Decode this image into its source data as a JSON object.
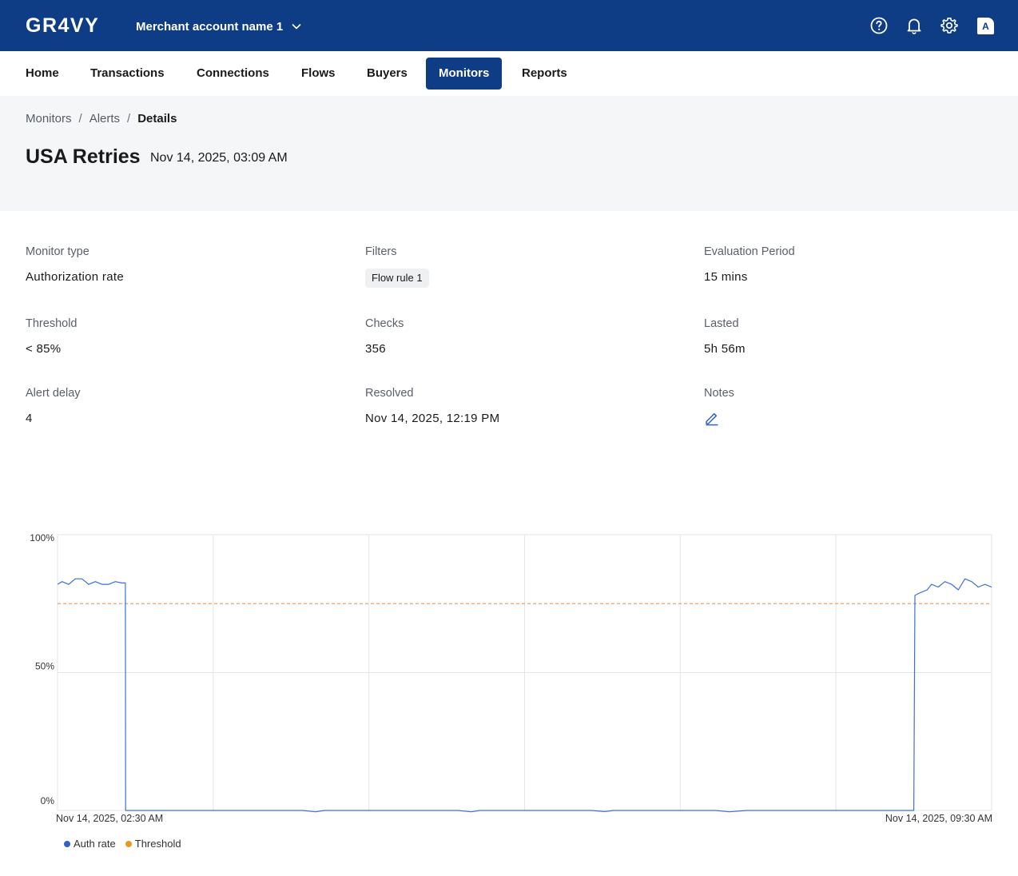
{
  "app": {
    "logo": "GR4VY"
  },
  "topbar": {
    "merchant": "Merchant account name 1",
    "avatar_letter": "A"
  },
  "nav": {
    "items": [
      {
        "label": "Home"
      },
      {
        "label": "Transactions"
      },
      {
        "label": "Connections"
      },
      {
        "label": "Flows"
      },
      {
        "label": "Buyers"
      },
      {
        "label": "Monitors",
        "active": true
      },
      {
        "label": "Reports"
      }
    ]
  },
  "breadcrumb": [
    "Monitors",
    "Alerts",
    "Details"
  ],
  "page": {
    "title": "USA Retries",
    "date": "Nov 14, 2025, 03:09 AM"
  },
  "details": {
    "monitor_type": {
      "label": "Monitor type",
      "value": "Authorization rate"
    },
    "filters": {
      "label": "Filters",
      "chip": "Flow rule 1"
    },
    "evaluation_period": {
      "label": "Evaluation Period",
      "value": "15 mins"
    },
    "threshold": {
      "label": "Threshold",
      "value": "< 85%"
    },
    "checks": {
      "label": "Checks",
      "value": "356"
    },
    "lasted": {
      "label": "Lasted",
      "value": "5h 56m"
    },
    "alert_delay": {
      "label": "Alert delay",
      "value": "4"
    },
    "resolved": {
      "label": "Resolved",
      "value": "Nov 14, 2025, 12:19 PM"
    },
    "notes": {
      "label": "Notes"
    }
  },
  "colors": {
    "brand": "#0e3d86",
    "auth_rate_line": "#3b6fd8",
    "threshold_line": "#f0a060",
    "grid": "#e6e6e6"
  },
  "chart_data": {
    "type": "line",
    "y_tick_labels": [
      "100%",
      "50%",
      "0%"
    ],
    "x_tick_labels": [
      "Nov 14, 2025, 02:30 AM",
      "Nov 14, 2025, 09:30 AM"
    ],
    "ylim": [
      0,
      100
    ],
    "x_range_minutes": [
      0,
      420
    ],
    "grid": true,
    "legend": "bottom-left",
    "series": [
      {
        "name": "Auth rate",
        "color": "#3b6fd8",
        "x_minutes": [
          0,
          2,
          5,
          8,
          11,
          14,
          17,
          20,
          23,
          26,
          29,
          30.5,
          30.6,
          60,
          110,
          116,
          120,
          160,
          180,
          186,
          190,
          230,
          240,
          246,
          250,
          280,
          296,
          302,
          310,
          385,
          385.5,
          388,
          391,
          393,
          396,
          399,
          402,
          405,
          408,
          411,
          414,
          417,
          420
        ],
        "values": [
          82,
          83,
          82,
          84,
          84,
          82,
          83,
          82,
          82,
          83,
          82.5,
          82.5,
          0,
          0,
          0,
          -0.5,
          0,
          0,
          0,
          -0.5,
          0,
          0,
          0,
          -0.4,
          0,
          0,
          0,
          -0.5,
          0,
          0,
          78,
          79,
          80,
          82,
          81,
          83,
          82,
          80,
          84,
          83,
          81,
          82,
          81
        ]
      },
      {
        "name": "Threshold",
        "color": "#f0a060",
        "value": 75
      }
    ]
  }
}
